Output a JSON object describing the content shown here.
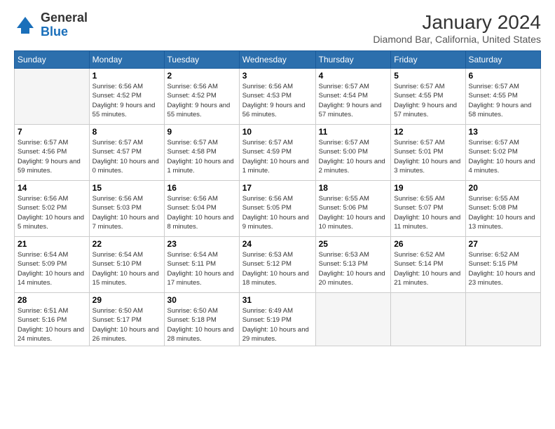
{
  "header": {
    "logo_general": "General",
    "logo_blue": "Blue",
    "title": "January 2024",
    "location": "Diamond Bar, California, United States"
  },
  "columns": [
    "Sunday",
    "Monday",
    "Tuesday",
    "Wednesday",
    "Thursday",
    "Friday",
    "Saturday"
  ],
  "weeks": [
    [
      {
        "day": "",
        "sunrise": "",
        "sunset": "",
        "daylight": ""
      },
      {
        "day": "1",
        "sunrise": "Sunrise: 6:56 AM",
        "sunset": "Sunset: 4:52 PM",
        "daylight": "Daylight: 9 hours and 55 minutes."
      },
      {
        "day": "2",
        "sunrise": "Sunrise: 6:56 AM",
        "sunset": "Sunset: 4:52 PM",
        "daylight": "Daylight: 9 hours and 55 minutes."
      },
      {
        "day": "3",
        "sunrise": "Sunrise: 6:56 AM",
        "sunset": "Sunset: 4:53 PM",
        "daylight": "Daylight: 9 hours and 56 minutes."
      },
      {
        "day": "4",
        "sunrise": "Sunrise: 6:57 AM",
        "sunset": "Sunset: 4:54 PM",
        "daylight": "Daylight: 9 hours and 57 minutes."
      },
      {
        "day": "5",
        "sunrise": "Sunrise: 6:57 AM",
        "sunset": "Sunset: 4:55 PM",
        "daylight": "Daylight: 9 hours and 57 minutes."
      },
      {
        "day": "6",
        "sunrise": "Sunrise: 6:57 AM",
        "sunset": "Sunset: 4:55 PM",
        "daylight": "Daylight: 9 hours and 58 minutes."
      }
    ],
    [
      {
        "day": "7",
        "sunrise": "Sunrise: 6:57 AM",
        "sunset": "Sunset: 4:56 PM",
        "daylight": "Daylight: 9 hours and 59 minutes."
      },
      {
        "day": "8",
        "sunrise": "Sunrise: 6:57 AM",
        "sunset": "Sunset: 4:57 PM",
        "daylight": "Daylight: 10 hours and 0 minutes."
      },
      {
        "day": "9",
        "sunrise": "Sunrise: 6:57 AM",
        "sunset": "Sunset: 4:58 PM",
        "daylight": "Daylight: 10 hours and 1 minute."
      },
      {
        "day": "10",
        "sunrise": "Sunrise: 6:57 AM",
        "sunset": "Sunset: 4:59 PM",
        "daylight": "Daylight: 10 hours and 1 minute."
      },
      {
        "day": "11",
        "sunrise": "Sunrise: 6:57 AM",
        "sunset": "Sunset: 5:00 PM",
        "daylight": "Daylight: 10 hours and 2 minutes."
      },
      {
        "day": "12",
        "sunrise": "Sunrise: 6:57 AM",
        "sunset": "Sunset: 5:01 PM",
        "daylight": "Daylight: 10 hours and 3 minutes."
      },
      {
        "day": "13",
        "sunrise": "Sunrise: 6:57 AM",
        "sunset": "Sunset: 5:02 PM",
        "daylight": "Daylight: 10 hours and 4 minutes."
      }
    ],
    [
      {
        "day": "14",
        "sunrise": "Sunrise: 6:56 AM",
        "sunset": "Sunset: 5:02 PM",
        "daylight": "Daylight: 10 hours and 5 minutes."
      },
      {
        "day": "15",
        "sunrise": "Sunrise: 6:56 AM",
        "sunset": "Sunset: 5:03 PM",
        "daylight": "Daylight: 10 hours and 7 minutes."
      },
      {
        "day": "16",
        "sunrise": "Sunrise: 6:56 AM",
        "sunset": "Sunset: 5:04 PM",
        "daylight": "Daylight: 10 hours and 8 minutes."
      },
      {
        "day": "17",
        "sunrise": "Sunrise: 6:56 AM",
        "sunset": "Sunset: 5:05 PM",
        "daylight": "Daylight: 10 hours and 9 minutes."
      },
      {
        "day": "18",
        "sunrise": "Sunrise: 6:55 AM",
        "sunset": "Sunset: 5:06 PM",
        "daylight": "Daylight: 10 hours and 10 minutes."
      },
      {
        "day": "19",
        "sunrise": "Sunrise: 6:55 AM",
        "sunset": "Sunset: 5:07 PM",
        "daylight": "Daylight: 10 hours and 11 minutes."
      },
      {
        "day": "20",
        "sunrise": "Sunrise: 6:55 AM",
        "sunset": "Sunset: 5:08 PM",
        "daylight": "Daylight: 10 hours and 13 minutes."
      }
    ],
    [
      {
        "day": "21",
        "sunrise": "Sunrise: 6:54 AM",
        "sunset": "Sunset: 5:09 PM",
        "daylight": "Daylight: 10 hours and 14 minutes."
      },
      {
        "day": "22",
        "sunrise": "Sunrise: 6:54 AM",
        "sunset": "Sunset: 5:10 PM",
        "daylight": "Daylight: 10 hours and 15 minutes."
      },
      {
        "day": "23",
        "sunrise": "Sunrise: 6:54 AM",
        "sunset": "Sunset: 5:11 PM",
        "daylight": "Daylight: 10 hours and 17 minutes."
      },
      {
        "day": "24",
        "sunrise": "Sunrise: 6:53 AM",
        "sunset": "Sunset: 5:12 PM",
        "daylight": "Daylight: 10 hours and 18 minutes."
      },
      {
        "day": "25",
        "sunrise": "Sunrise: 6:53 AM",
        "sunset": "Sunset: 5:13 PM",
        "daylight": "Daylight: 10 hours and 20 minutes."
      },
      {
        "day": "26",
        "sunrise": "Sunrise: 6:52 AM",
        "sunset": "Sunset: 5:14 PM",
        "daylight": "Daylight: 10 hours and 21 minutes."
      },
      {
        "day": "27",
        "sunrise": "Sunrise: 6:52 AM",
        "sunset": "Sunset: 5:15 PM",
        "daylight": "Daylight: 10 hours and 23 minutes."
      }
    ],
    [
      {
        "day": "28",
        "sunrise": "Sunrise: 6:51 AM",
        "sunset": "Sunset: 5:16 PM",
        "daylight": "Daylight: 10 hours and 24 minutes."
      },
      {
        "day": "29",
        "sunrise": "Sunrise: 6:50 AM",
        "sunset": "Sunset: 5:17 PM",
        "daylight": "Daylight: 10 hours and 26 minutes."
      },
      {
        "day": "30",
        "sunrise": "Sunrise: 6:50 AM",
        "sunset": "Sunset: 5:18 PM",
        "daylight": "Daylight: 10 hours and 28 minutes."
      },
      {
        "day": "31",
        "sunrise": "Sunrise: 6:49 AM",
        "sunset": "Sunset: 5:19 PM",
        "daylight": "Daylight: 10 hours and 29 minutes."
      },
      {
        "day": "",
        "sunrise": "",
        "sunset": "",
        "daylight": ""
      },
      {
        "day": "",
        "sunrise": "",
        "sunset": "",
        "daylight": ""
      },
      {
        "day": "",
        "sunrise": "",
        "sunset": "",
        "daylight": ""
      }
    ]
  ]
}
